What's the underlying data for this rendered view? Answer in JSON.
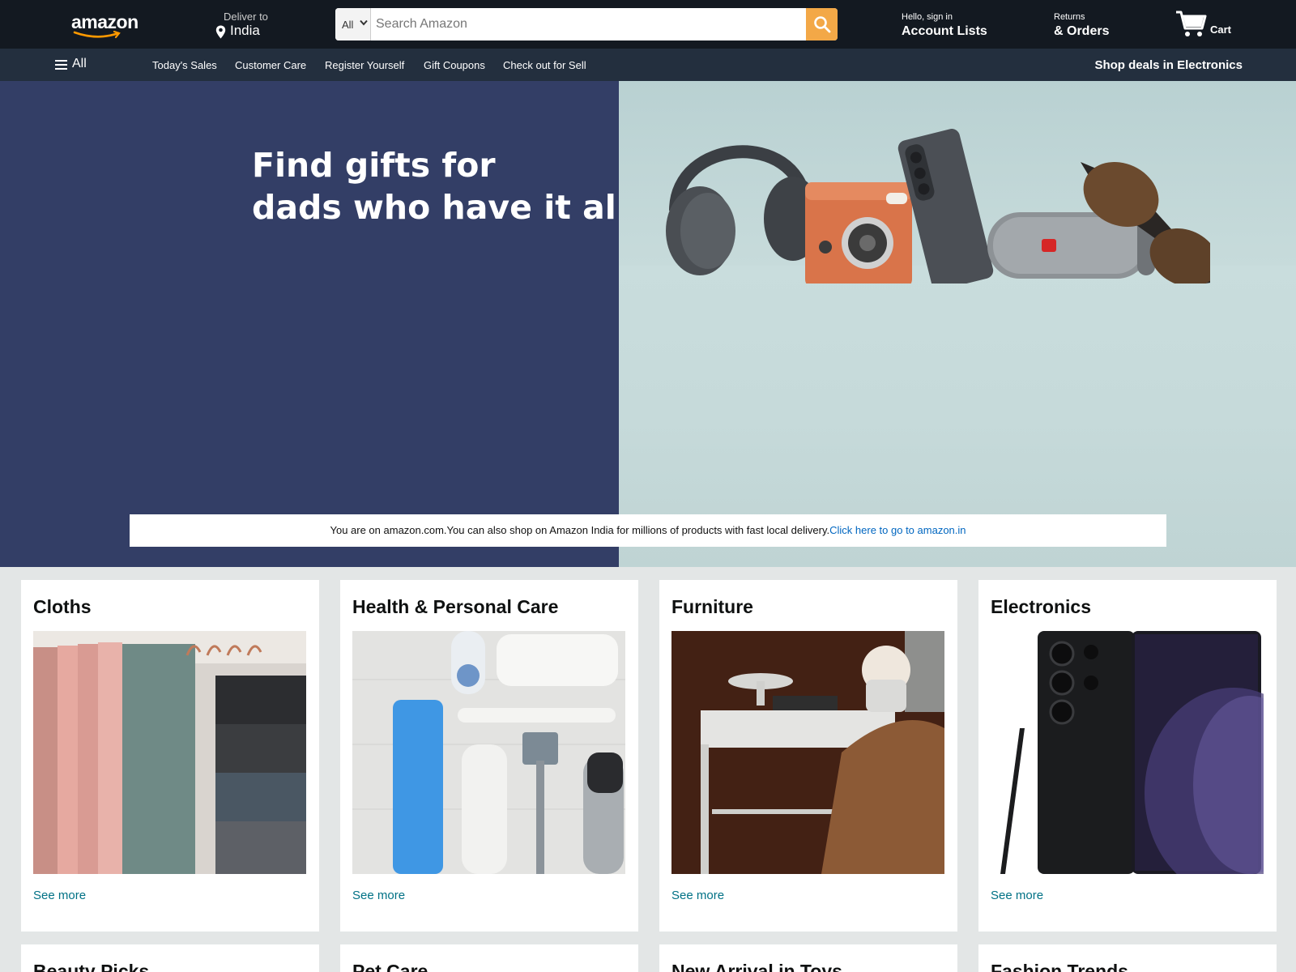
{
  "header": {
    "logo_text": "amazon",
    "deliver_label": "Deliver to",
    "deliver_location": "India",
    "search_category": "All",
    "search_placeholder": "Search Amazon",
    "account_small": "Hello, sign in",
    "account_big": "Account Lists",
    "returns_small": "Returns",
    "returns_big": "& Orders",
    "cart_label": "Cart"
  },
  "subnav": {
    "all_label": "All",
    "links": [
      "Today's Sales",
      "Customer Care",
      "Register Yourself",
      "Gift Coupons",
      "Check out for Sell"
    ],
    "deals": "Shop deals in Electronics"
  },
  "hero": {
    "title_line1": "Find gifts for",
    "title_line2": "dads who have it all",
    "notice_text": "You are on amazon.com.You can also shop on Amazon India for millions of products with fast local delivery.",
    "notice_link": "Click here to go to amazon.in"
  },
  "cards": [
    {
      "title": "Cloths",
      "link": "See more"
    },
    {
      "title": "Health & Personal Care",
      "link": "See more"
    },
    {
      "title": "Furniture",
      "link": "See more"
    },
    {
      "title": "Electronics",
      "link": "See more"
    }
  ],
  "cards_row2": [
    {
      "title": "Beauty Picks"
    },
    {
      "title": "Pet Care"
    },
    {
      "title": "New Arrival in Toys"
    },
    {
      "title": "Fashion Trends"
    }
  ],
  "colors": {
    "nav_bg": "#131921",
    "subnav_bg": "#232f3e",
    "search_button": "#f3a847",
    "hero_left": "#333e66",
    "link": "#007185"
  },
  "icons": {
    "location": "map-pin-icon",
    "search": "magnifier-icon",
    "cart": "cart-icon",
    "menu": "hamburger-icon",
    "dropdown": "chevron-down-icon"
  }
}
